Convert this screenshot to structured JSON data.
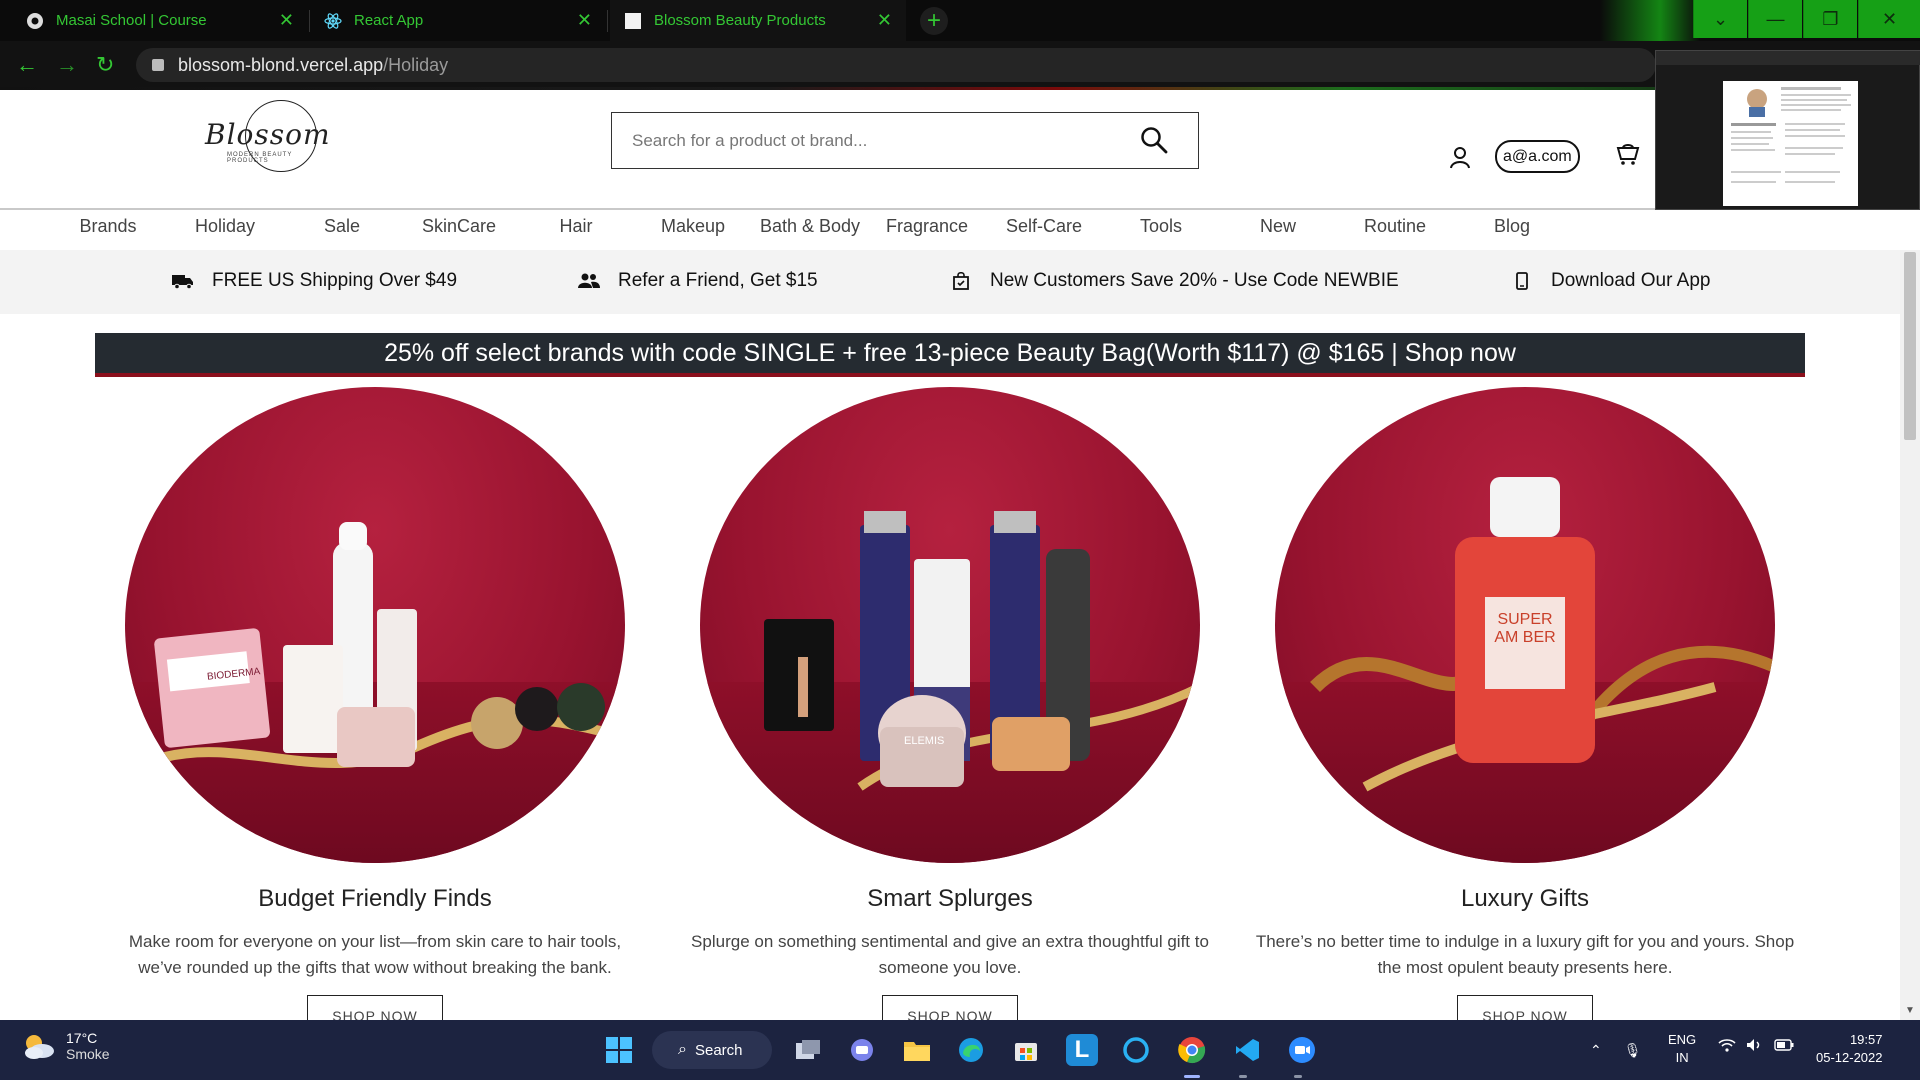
{
  "browser": {
    "tabs": [
      {
        "title": "Masai School | Course",
        "active": false
      },
      {
        "title": "React App",
        "active": false
      },
      {
        "title": "Blossom Beauty Products",
        "active": true
      }
    ],
    "url_host": "blossom-blond.vercel.app",
    "url_path": "/Holiday",
    "accent_color": "#34c734"
  },
  "header": {
    "logo_text": "Blossom",
    "logo_tagline": "MODERN BEAUTY PRODUCTS",
    "search_placeholder": "Search for a product ot brand...",
    "user_email": "a@a.com"
  },
  "nav": {
    "items": [
      "Brands",
      "Holiday",
      "Sale",
      "SkinCare",
      "Hair",
      "Makeup",
      "Bath & Body",
      "Fragrance",
      "Self-Care",
      "Tools",
      "New",
      "Routine",
      "Blog"
    ]
  },
  "promos": [
    {
      "icon": "truck-icon",
      "text": "FREE US Shipping Over $49"
    },
    {
      "icon": "users-icon",
      "text": "Refer a Friend, Get $15"
    },
    {
      "icon": "gift-bag-icon",
      "text": "New Customers Save 20% - Use Code NEWBIE"
    },
    {
      "icon": "phone-icon",
      "text": "Download Our App"
    }
  ],
  "offer_banner": "25% off select brands with code SINGLE + free 13-piece Beauty Bag(Worth $117) @ $165 | Shop now",
  "cards": [
    {
      "title": "Budget Friendly Finds",
      "description": "Make room for everyone on your list—from skin care to hair tools, we’ve rounded up the gifts that wow without breaking the bank.",
      "button": "SHOP NOW",
      "product_label": "BIODERMA"
    },
    {
      "title": "Smart Splurges",
      "description": "Splurge on something sentimental and give an extra thoughtful gift to someone you love.",
      "button": "SHOP NOW",
      "product_label": "ELEMIS"
    },
    {
      "title": "Luxury Gifts",
      "description": "There’s no better time to indulge in a luxury gift for you and yours. Shop the most opulent beauty presents here.",
      "button": "SHOP NOW",
      "product_label": "SUPER AM BER"
    }
  ],
  "taskbar": {
    "temperature": "17°C",
    "weather": "Smoke",
    "search_label": "Search",
    "lang_line1": "ENG",
    "lang_line2": "IN",
    "time": "19:57",
    "date": "05-12-2022"
  }
}
